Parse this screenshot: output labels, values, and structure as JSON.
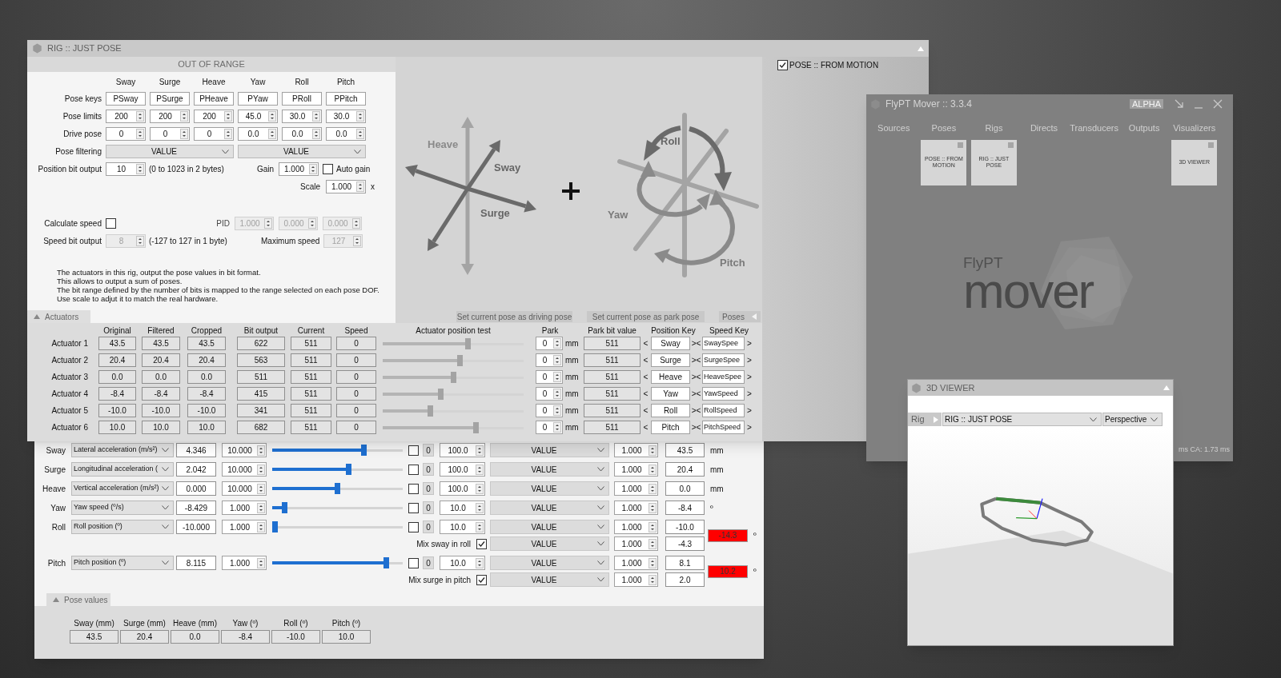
{
  "rig_window": {
    "title": "RIG :: JUST POSE",
    "banner": "OUT OF RANGE",
    "dof_columns": [
      "Sway",
      "Surge",
      "Heave",
      "Yaw",
      "Roll",
      "Pitch"
    ],
    "pose_rows": [
      {
        "label": "Pose keys",
        "kind": "text",
        "values": [
          "PSway",
          "PSurge",
          "PHeave",
          "PYaw",
          "PRoll",
          "PPitch"
        ]
      },
      {
        "label": "Pose limits",
        "kind": "spin",
        "values": [
          "200",
          "200",
          "200",
          "45.0",
          "30.0",
          "30.0"
        ]
      },
      {
        "label": "Drive pose",
        "kind": "spin",
        "values": [
          "0",
          "0",
          "0",
          "0.0",
          "0.0",
          "0.0"
        ]
      }
    ],
    "pose_filtering": {
      "label": "Pose filtering",
      "selects": [
        "VALUE",
        "VALUE"
      ]
    },
    "position_bit_output": {
      "label": "Position bit output",
      "value": "10",
      "note": "(0 to 1023 in 2 bytes)"
    },
    "gain": {
      "label": "Gain",
      "value": "1.000"
    },
    "auto_gain": {
      "label": "Auto gain",
      "checked": false
    },
    "scale": {
      "label": "Scale",
      "value": "1.000",
      "unit": "x"
    },
    "calculate_speed": {
      "label": "Calculate speed",
      "checked": false
    },
    "pid": {
      "label": "PID",
      "values": [
        "1.000",
        "0.000",
        "0.000"
      ],
      "disabled": true
    },
    "speed_bit_output": {
      "label": "Speed bit output",
      "value": "8",
      "note": "(-127 to 127 in 1 byte)",
      "disabled": true
    },
    "maximum_speed": {
      "label": "Maximum speed",
      "value": "127",
      "disabled": true
    },
    "description": [
      "The actuators in this rig, output the pose values in bit format.",
      "This allows to output a sum of poses.",
      "The bit range defined by the number of bits is mapped to the range selected on each pose DOF.",
      "Use scale to adjut it to match the real hardware."
    ],
    "diagram": {
      "translation_labels": [
        "Heave",
        "Sway",
        "Surge"
      ],
      "rotation_labels": [
        "Roll",
        "Yaw",
        "Pitch"
      ]
    },
    "actuators_tab": {
      "label": "Actuators",
      "expanded": true
    },
    "buttons": [
      "Set current pose as driving pose",
      "Set current pose as park pose"
    ],
    "poses_tab": {
      "label": "Poses",
      "expanded": false
    },
    "actuator_columns": [
      "Original",
      "Filtered",
      "Cropped",
      "Bit output",
      "Current",
      "Speed",
      "Actuator position test",
      "Park",
      "Park bit value",
      "Position Key",
      "Speed Key"
    ],
    "actuators": [
      {
        "name": "Actuator 1",
        "original": "43.5",
        "filtered": "43.5",
        "cropped": "43.5",
        "bit_output": "622",
        "current": "511",
        "speed": "0",
        "level": 0.61,
        "park": "0",
        "park_unit": "mm",
        "park_bit_value": "511",
        "left_bracket": "<",
        "position_key": "Sway",
        "mid_bracket": "><",
        "speed_key": "SwaySpee",
        "right_bracket": ">"
      },
      {
        "name": "Actuator 2",
        "original": "20.4",
        "filtered": "20.4",
        "cropped": "20.4",
        "bit_output": "563",
        "current": "511",
        "speed": "0",
        "level": 0.55,
        "park": "0",
        "park_unit": "mm",
        "park_bit_value": "511",
        "left_bracket": "<",
        "position_key": "Surge",
        "mid_bracket": "><",
        "speed_key": "SurgeSpee",
        "right_bracket": ">"
      },
      {
        "name": "Actuator 3",
        "original": "0.0",
        "filtered": "0.0",
        "cropped": "0.0",
        "bit_output": "511",
        "current": "511",
        "speed": "0",
        "level": 0.5,
        "park": "0",
        "park_unit": "mm",
        "park_bit_value": "511",
        "left_bracket": "<",
        "position_key": "Heave",
        "mid_bracket": "><",
        "speed_key": "HeaveSpee",
        "right_bracket": ">"
      },
      {
        "name": "Actuator 4",
        "original": "-8.4",
        "filtered": "-8.4",
        "cropped": "-8.4",
        "bit_output": "415",
        "current": "511",
        "speed": "0",
        "level": 0.41,
        "park": "0",
        "park_unit": "mm",
        "park_bit_value": "511",
        "left_bracket": "<",
        "position_key": "Yaw",
        "mid_bracket": "><",
        "speed_key": "YawSpeed",
        "right_bracket": ">"
      },
      {
        "name": "Actuator 5",
        "original": "-10.0",
        "filtered": "-10.0",
        "cropped": "-10.0",
        "bit_output": "341",
        "current": "511",
        "speed": "0",
        "level": 0.33,
        "park": "0",
        "park_unit": "mm",
        "park_bit_value": "511",
        "left_bracket": "<",
        "position_key": "Roll",
        "mid_bracket": "><",
        "speed_key": "RollSpeed",
        "right_bracket": ">"
      },
      {
        "name": "Actuator 6",
        "original": "10.0",
        "filtered": "10.0",
        "cropped": "10.0",
        "bit_output": "682",
        "current": "511",
        "speed": "0",
        "level": 0.67,
        "park": "0",
        "park_unit": "mm",
        "park_bit_value": "511",
        "left_bracket": "<",
        "position_key": "Pitch",
        "mid_bracket": "><",
        "speed_key": "PitchSpeed",
        "right_bracket": ">"
      }
    ],
    "source": {
      "label": "POSE :: FROM MOTION",
      "checked": true
    }
  },
  "pose_window": {
    "rows": [
      {
        "dof": "Sway",
        "source": "Lateral acceleration (m/s²)",
        "input": "4.346",
        "gain": "10.000",
        "level": 0.71,
        "enabled": false,
        "zero": "0",
        "range": "100.0",
        "filter": "VALUE",
        "filter_gain": "1.000",
        "output": "43.5",
        "unit": "mm"
      },
      {
        "dof": "Surge",
        "source": "Longitudinal acceleration (",
        "input": "2.042",
        "gain": "10.000",
        "level": 0.59,
        "enabled": false,
        "zero": "0",
        "range": "100.0",
        "filter": "VALUE",
        "filter_gain": "1.000",
        "output": "20.4",
        "unit": "mm"
      },
      {
        "dof": "Heave",
        "source": "Vertical acceleration (m/s²)",
        "input": "0.000",
        "gain": "10.000",
        "level": 0.5,
        "enabled": false,
        "zero": "0",
        "range": "100.0",
        "filter": "VALUE",
        "filter_gain": "1.000",
        "output": "0.0",
        "unit": "mm"
      },
      {
        "dof": "Yaw",
        "source": "Yaw speed (º/s)",
        "input": "-8.429",
        "gain": "1.000",
        "level": 0.08,
        "enabled": false,
        "zero": "0",
        "range": "10.0",
        "filter": "VALUE",
        "filter_gain": "1.000",
        "output": "-8.4",
        "unit": "º"
      },
      {
        "dof": "Roll",
        "source": "Roll position (º)",
        "input": "-10.000",
        "gain": "1.000",
        "level": 0.0,
        "enabled": false,
        "zero": "0",
        "range": "10.0",
        "filter": "VALUE",
        "filter_gain": "1.000",
        "output": "-10.0",
        "mix": {
          "label": "Mix sway in roll",
          "checked": true,
          "filter": "VALUE",
          "gain": "1.000",
          "output": "-4.3"
        },
        "total": "-14.3",
        "unit": "º"
      },
      {
        "dof": "Pitch",
        "source": "Pitch position (º)",
        "input": "8.115",
        "gain": "1.000",
        "level": 0.89,
        "enabled": false,
        "zero": "0",
        "range": "10.0",
        "filter": "VALUE",
        "filter_gain": "1.000",
        "output": "8.1",
        "mix": {
          "label": "Mix surge in pitch",
          "checked": true,
          "filter": "VALUE",
          "gain": "1.000",
          "output": "2.0"
        },
        "total": "10.2",
        "unit": "º"
      }
    ],
    "pose_values_tab": {
      "label": "Pose values",
      "expanded": true
    },
    "pose_values": [
      {
        "label": "Sway (mm)",
        "value": "43.5"
      },
      {
        "label": "Surge (mm)",
        "value": "20.4"
      },
      {
        "label": "Heave (mm)",
        "value": "0.0"
      },
      {
        "label": "Yaw (º)",
        "value": "-8.4"
      },
      {
        "label": "Roll (º)",
        "value": "-10.0"
      },
      {
        "label": "Pitch (º)",
        "value": "10.0"
      }
    ]
  },
  "mover_window": {
    "title": "FlyPT Mover :: 3.3.4",
    "badge": "ALPHA",
    "categories": [
      {
        "label": "Sources"
      },
      {
        "label": "Poses",
        "nodes": [
          "POSE :: FROM MOTION"
        ]
      },
      {
        "label": "Rigs",
        "nodes": [
          "RIG :: JUST POSE"
        ]
      },
      {
        "label": "Directs"
      },
      {
        "label": "Transducers"
      },
      {
        "label": "Outputs"
      },
      {
        "label": "Visualizers",
        "nodes": [
          "3D VIEWER"
        ]
      }
    ],
    "logo_small": "FlyPT",
    "logo_large": "mover",
    "status": "ms CA: 1.73 ms"
  },
  "viewer_window": {
    "title": "3D VIEWER",
    "rig_label": "Rig",
    "rig": "RIG :: JUST POSE",
    "view": "Perspective"
  }
}
